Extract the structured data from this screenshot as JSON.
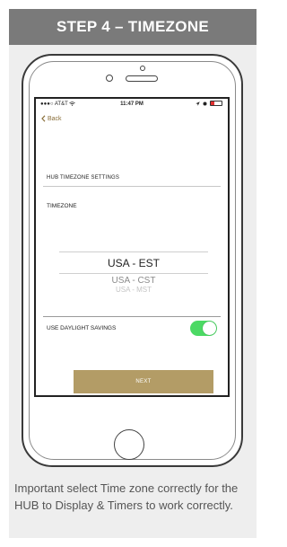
{
  "header": {
    "title": "STEP 4 – TIMEZONE"
  },
  "status_bar": {
    "carrier": "AT&T",
    "time": "11:47 PM"
  },
  "nav": {
    "back_label": "Back"
  },
  "settings": {
    "section_title": "HUB TIMEZONE SETTINGS",
    "timezone_label": "TIMEZONE",
    "picker_options": [
      "USA - EST",
      "USA - CST",
      "USA - MST"
    ],
    "selected_option": "USA - EST",
    "daylight_savings_label": "USE DAYLIGHT SAVINGS",
    "daylight_savings_on": true,
    "next_label": "NEXT"
  },
  "caption": "Important select Time zone correctly for the HUB to Display & Timers to work correctly.",
  "colors": {
    "header_bg": "#7a7a7a",
    "panel_bg": "#eeeeee",
    "accent_gold": "#b39c66",
    "toggle_green": "#4cd964"
  },
  "icons": [
    "wifi-icon",
    "location-icon",
    "battery-icon",
    "chevron-left-icon"
  ]
}
